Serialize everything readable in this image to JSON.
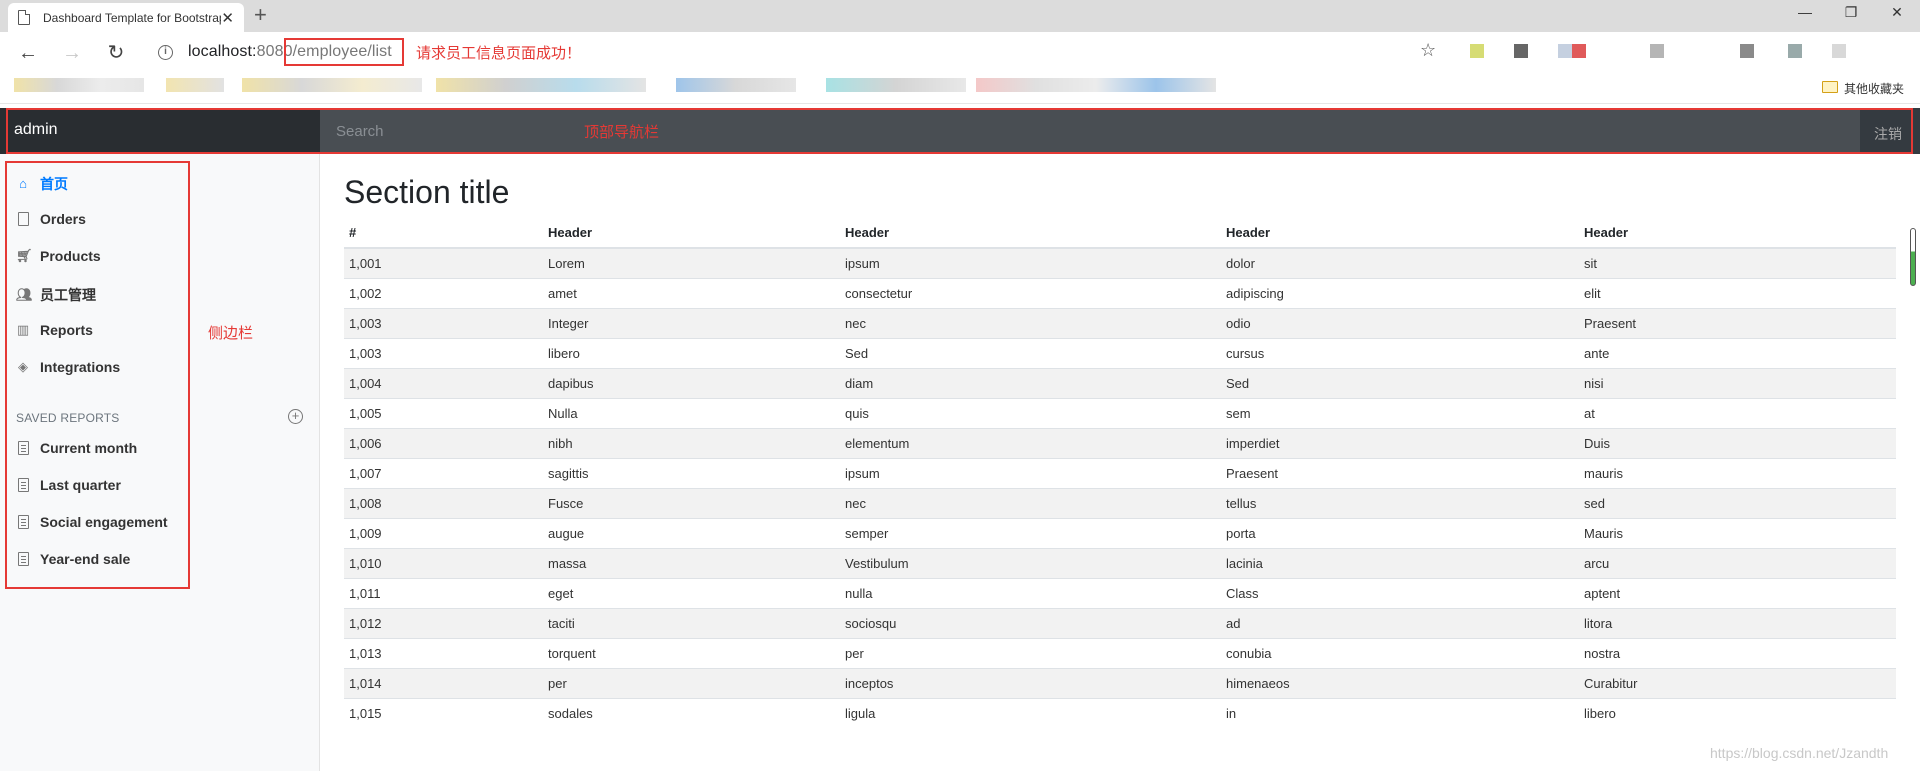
{
  "browser": {
    "tab_title": "Dashboard Template for Bootstrap",
    "url_host": "localhost:",
    "url_port": "8080",
    "url_path": "/employee/list",
    "other_bookmarks": "其他收藏夹",
    "annotation_url": "请求员工信息页面成功！"
  },
  "navbar": {
    "brand": "admin",
    "search_placeholder": "Search",
    "logout": "注销",
    "annotation": "顶部导航栏"
  },
  "sidebar": {
    "items": [
      {
        "label": "首页",
        "icon": "home-icon",
        "active": true
      },
      {
        "label": "Orders",
        "icon": "file-icon"
      },
      {
        "label": "Products",
        "icon": "cart-icon"
      },
      {
        "label": "员工管理",
        "icon": "users-icon"
      },
      {
        "label": "Reports",
        "icon": "bar-chart-icon"
      },
      {
        "label": "Integrations",
        "icon": "layers-icon"
      }
    ],
    "saved_reports_heading": "SAVED REPORTS",
    "saved_reports": [
      {
        "label": "Current month"
      },
      {
        "label": "Last quarter"
      },
      {
        "label": "Social engagement"
      },
      {
        "label": "Year-end sale"
      }
    ],
    "annotation": "侧边栏"
  },
  "main": {
    "section_title": "Section title",
    "table": {
      "headers": [
        "#",
        "Header",
        "Header",
        "Header",
        "Header"
      ],
      "rows": [
        [
          "1,001",
          "Lorem",
          "ipsum",
          "dolor",
          "sit"
        ],
        [
          "1,002",
          "amet",
          "consectetur",
          "adipiscing",
          "elit"
        ],
        [
          "1,003",
          "Integer",
          "nec",
          "odio",
          "Praesent"
        ],
        [
          "1,003",
          "libero",
          "Sed",
          "cursus",
          "ante"
        ],
        [
          "1,004",
          "dapibus",
          "diam",
          "Sed",
          "nisi"
        ],
        [
          "1,005",
          "Nulla",
          "quis",
          "sem",
          "at"
        ],
        [
          "1,006",
          "nibh",
          "elementum",
          "imperdiet",
          "Duis"
        ],
        [
          "1,007",
          "sagittis",
          "ipsum",
          "Praesent",
          "mauris"
        ],
        [
          "1,008",
          "Fusce",
          "nec",
          "tellus",
          "sed"
        ],
        [
          "1,009",
          "augue",
          "semper",
          "porta",
          "Mauris"
        ],
        [
          "1,010",
          "massa",
          "Vestibulum",
          "lacinia",
          "arcu"
        ],
        [
          "1,011",
          "eget",
          "nulla",
          "Class",
          "aptent"
        ],
        [
          "1,012",
          "taciti",
          "sociosqu",
          "ad",
          "litora"
        ],
        [
          "1,013",
          "torquent",
          "per",
          "conubia",
          "nostra"
        ],
        [
          "1,014",
          "per",
          "inceptos",
          "himenaeos",
          "Curabitur"
        ],
        [
          "1,015",
          "sodales",
          "ligula",
          "in",
          "libero"
        ]
      ]
    }
  },
  "watermark": "https://blog.csdn.net/Jzandth"
}
